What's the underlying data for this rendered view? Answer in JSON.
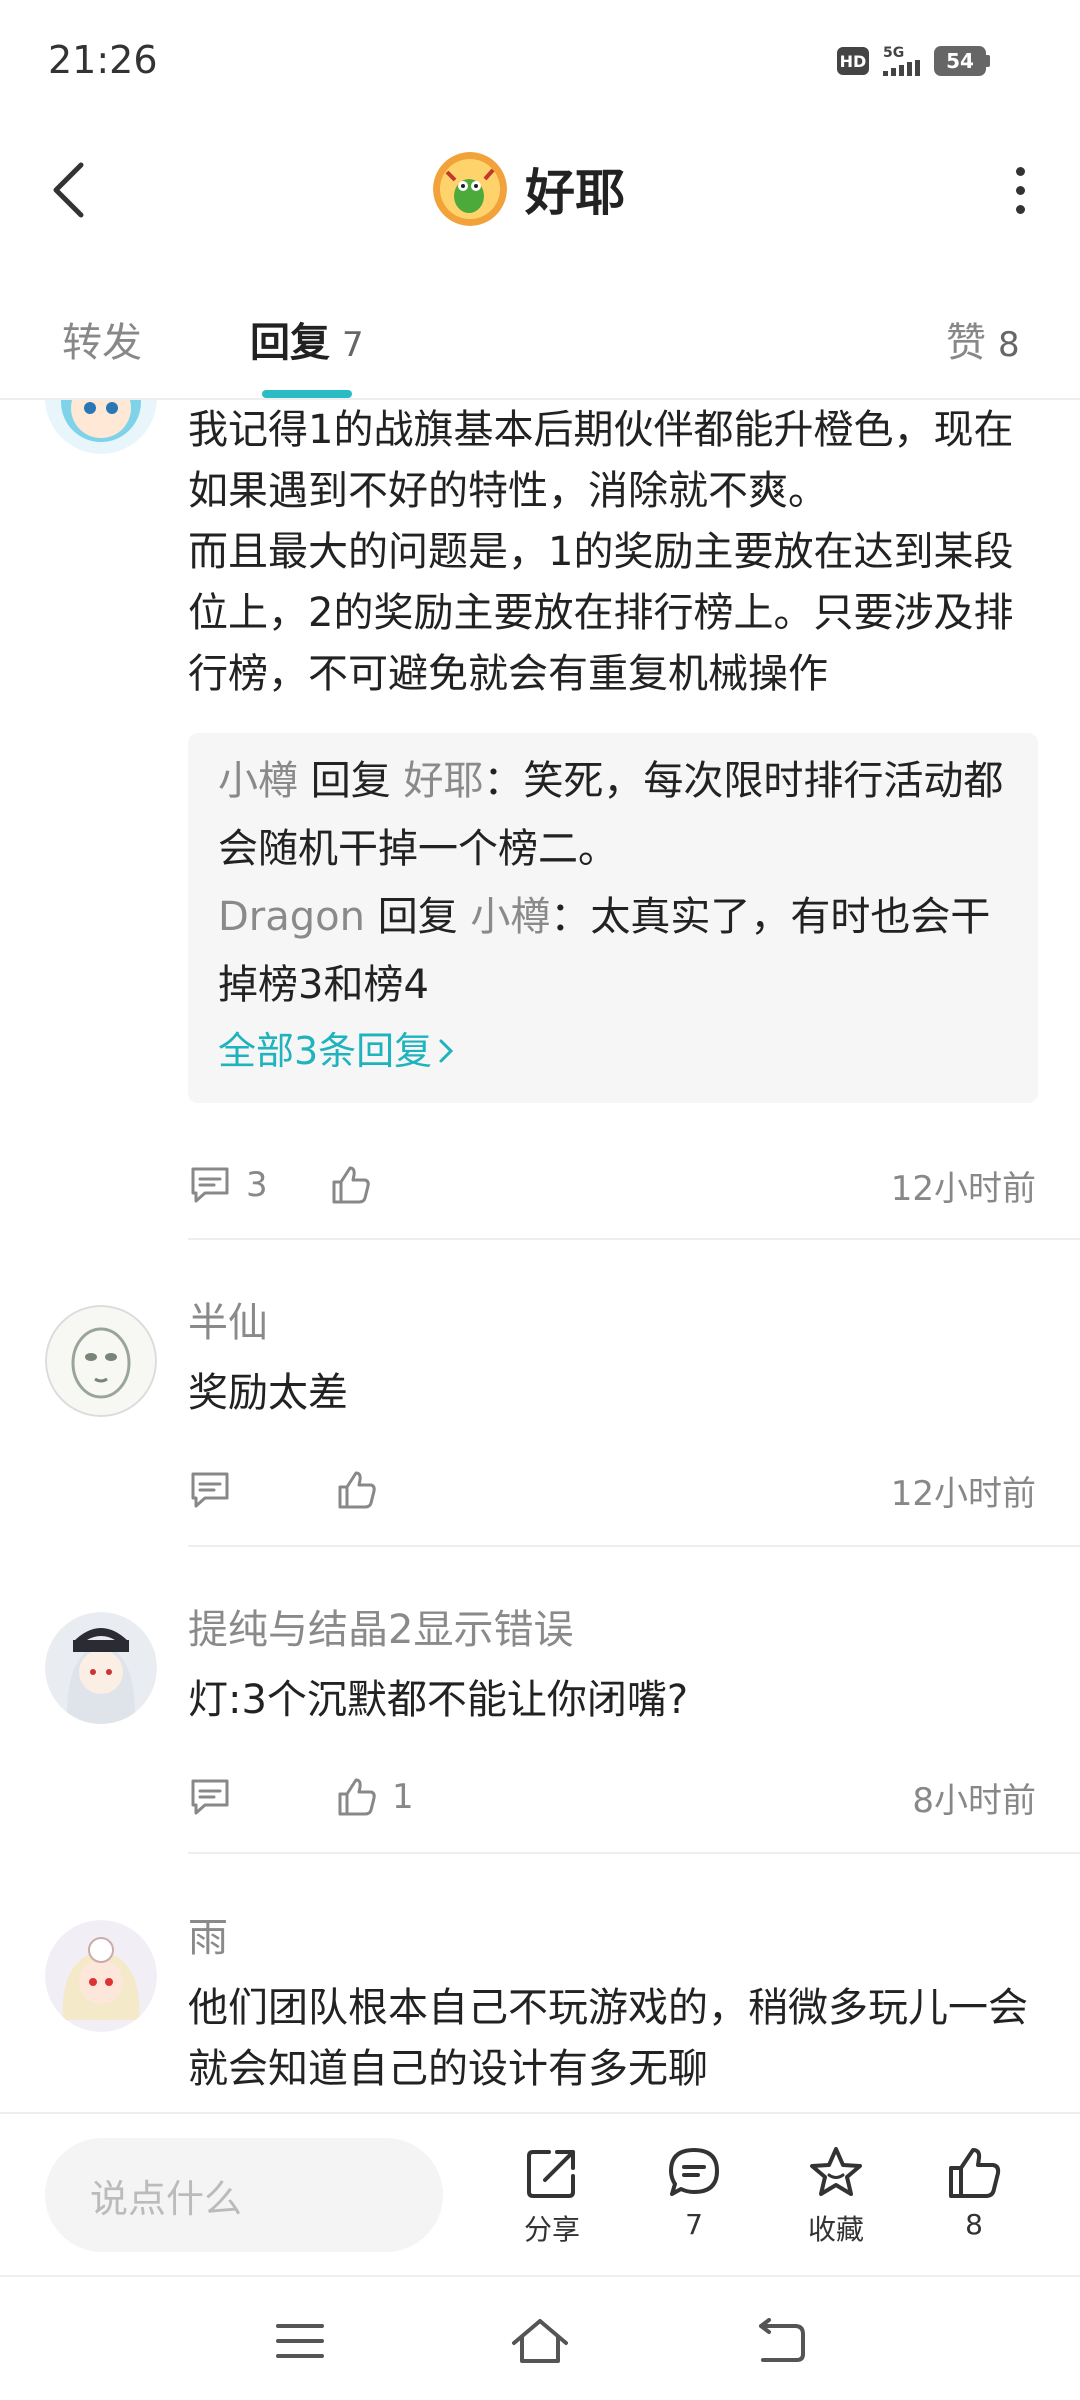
{
  "status_bar": {
    "time": "21:26",
    "hd": "HD",
    "network": "5G",
    "battery": "54"
  },
  "header": {
    "title": "好耶"
  },
  "tabs": {
    "repost": {
      "label": "转发"
    },
    "reply": {
      "label": "回复",
      "count": "7"
    },
    "like": {
      "label": "赞",
      "count": "8"
    }
  },
  "comments": [
    {
      "text": "我记得1的战旗基本后期伙伴都能升橙色，现在如果遇到不好的特性，消除就不爽。\n而且最大的问题是，1的奖励主要放在达到某段位上，2的奖励主要放在排行榜上。只要涉及排行榜，不可避免就会有重复机械操作",
      "replies": [
        {
          "from": "小樽",
          "verb": "回复",
          "to": "好耶",
          "text": "：笑死，每次限时排行活动都会随机干掉一个榜二。"
        },
        {
          "from": "Dragon",
          "verb": "回复",
          "to": "小樽",
          "text": "：太真实了，有时也会干掉榜3和榜4"
        }
      ],
      "more_replies": "全部3条回复",
      "reply_count": "3",
      "like_count": "",
      "time": "12小时前"
    },
    {
      "name": "半仙",
      "text": "奖励太差",
      "reply_count": "",
      "like_count": "",
      "time": "12小时前"
    },
    {
      "name": "提纯与结晶2显示错误",
      "text": "灯:3个沉默都不能让你闭嘴?",
      "reply_count": "",
      "like_count": "1",
      "time": "8小时前"
    },
    {
      "name": "雨",
      "text": "他们团队根本自己不玩游戏的，稍微多玩儿一会就会知道自己的设计有多无聊"
    }
  ],
  "bottom_bar": {
    "input_placeholder": "说点什么",
    "share_label": "分享",
    "comment_count": "7",
    "favorite_label": "收藏",
    "like_count": "8"
  },
  "colors": {
    "accent": "#2abcc5",
    "link": "#1eb3bd",
    "muted": "#8a8a8a",
    "reply_bg": "#f6f6f6"
  }
}
